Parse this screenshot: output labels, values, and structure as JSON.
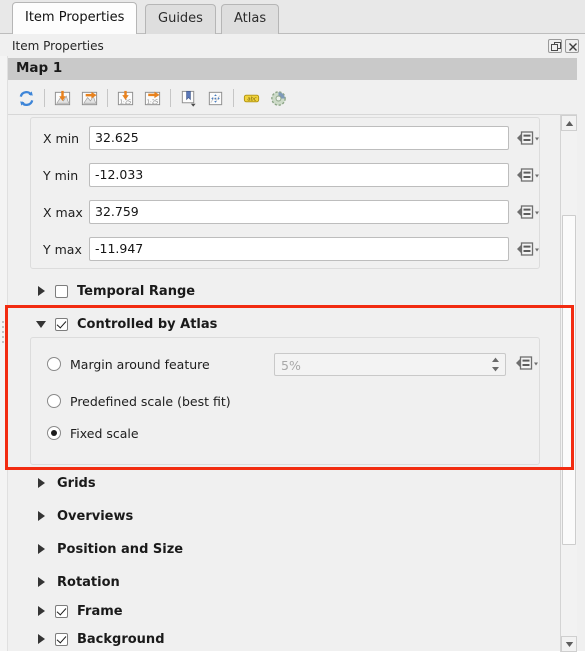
{
  "tabs": [
    {
      "label": "Item Properties",
      "active": true
    },
    {
      "label": "Guides",
      "active": false
    },
    {
      "label": "Atlas",
      "active": false
    }
  ],
  "panel": {
    "title": "Item Properties",
    "float_button": "float-icon",
    "close_button": "close-icon",
    "item_name": "Map 1"
  },
  "toolbar": {
    "buttons": [
      {
        "name": "refresh-view-icon",
        "tooltip": "Refresh view"
      },
      {
        "name": "set-map-extent-to-layers-icon",
        "tooltip": "Set map extent to match main canvas extent"
      },
      {
        "name": "view-extent-in-map-canvas-icon",
        "tooltip": "View extent in map canvas"
      },
      {
        "name": "set-map-scale-to-canvas-icon",
        "tooltip": "Set map scale to match main canvas scale"
      },
      {
        "name": "view-scale-in-map-canvas-icon",
        "tooltip": "View scale in map canvas"
      },
      {
        "name": "bookmarks-icon",
        "tooltip": "Bookmarks"
      },
      {
        "name": "interactively-edit-extent-icon",
        "tooltip": "Interactively edit map extent"
      },
      {
        "name": "labeling-icon",
        "tooltip": "Labeling settings"
      },
      {
        "name": "map-settings-icon",
        "tooltip": "Map settings"
      }
    ]
  },
  "extent": {
    "fields": [
      {
        "label": "X min",
        "value": "32.625",
        "override": "data-defined-override-icon"
      },
      {
        "label": "Y min",
        "value": "-12.033",
        "override": "data-defined-override-icon"
      },
      {
        "label": "X max",
        "value": "32.759",
        "override": "data-defined-override-icon"
      },
      {
        "label": "Y max",
        "value": "-11.947",
        "override": "data-defined-override-icon"
      }
    ]
  },
  "sections": {
    "temporal_range": {
      "label": "Temporal Range",
      "expanded": false,
      "checked": false,
      "has_checkbox": true
    },
    "controlled_by_atlas": {
      "label": "Controlled by Atlas",
      "expanded": true,
      "checked": true,
      "has_checkbox": true
    },
    "grids": {
      "label": "Grids",
      "expanded": false,
      "has_checkbox": false
    },
    "overviews": {
      "label": "Overviews",
      "expanded": false,
      "has_checkbox": false
    },
    "position_and_size": {
      "label": "Position and Size",
      "expanded": false,
      "has_checkbox": false
    },
    "rotation": {
      "label": "Rotation",
      "expanded": false,
      "has_checkbox": false
    },
    "frame": {
      "label": "Frame",
      "expanded": false,
      "checked": true,
      "has_checkbox": true
    },
    "background": {
      "label": "Background",
      "expanded": false,
      "checked": true,
      "has_checkbox": true
    }
  },
  "atlas": {
    "options": [
      {
        "label": "Margin around feature",
        "selected": false
      },
      {
        "label": "Predefined scale (best fit)",
        "selected": false
      },
      {
        "label": "Fixed scale",
        "selected": true
      }
    ],
    "margin_spinbox": {
      "placeholder": "5%",
      "value": "",
      "enabled": false,
      "override": "data-defined-override-icon"
    }
  },
  "highlight": {
    "color": "#f22c11",
    "target": "controlled-by-atlas-section"
  },
  "scrollbar": {
    "up_arrow": "scroll-up-icon",
    "down_arrow": "scroll-down-icon"
  }
}
